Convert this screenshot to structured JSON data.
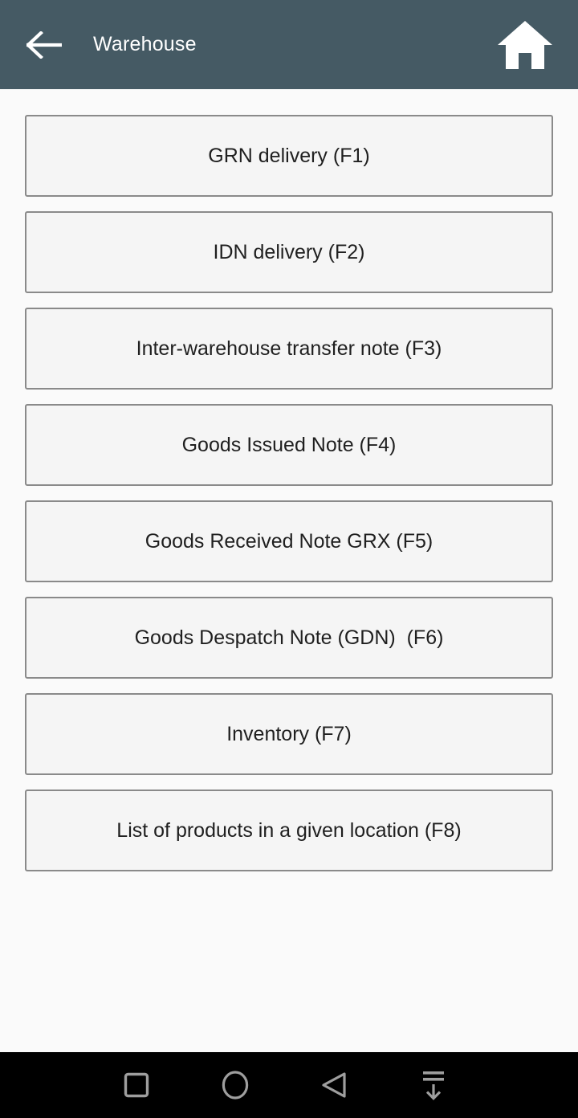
{
  "appbar": {
    "title": "Warehouse",
    "back_icon": "arrow-left-icon",
    "home_icon": "home-icon",
    "background_color": "#455a64",
    "text_color": "#ffffff"
  },
  "menu": {
    "buttons": [
      {
        "label": "GRN delivery (F1)",
        "shortcut": "F1"
      },
      {
        "label": "IDN delivery (F2)",
        "shortcut": "F2"
      },
      {
        "label": "Inter-warehouse transfer note (F3)",
        "shortcut": "F3"
      },
      {
        "label": "Goods Issued Note (F4)",
        "shortcut": "F4"
      },
      {
        "label": "Goods Received Note GRX (F5)",
        "shortcut": "F5"
      },
      {
        "label": "Goods Despatch Note (GDN)  (F6)",
        "shortcut": "F6"
      },
      {
        "label": "Inventory (F7)",
        "shortcut": "F7"
      },
      {
        "label": "List of products in a given location (F8)",
        "shortcut": "F8"
      }
    ],
    "button_background": "#f5f5f5",
    "button_border_color": "#8a8a8a",
    "button_text_color": "#1f1f1f",
    "page_background": "#fafafa"
  },
  "navbar": {
    "background_color": "#000000",
    "icon_color": "#9e9e9e",
    "items": [
      {
        "icon": "square-recents-icon",
        "label": "Recents"
      },
      {
        "icon": "circle-home-icon",
        "label": "Home"
      },
      {
        "icon": "triangle-back-icon",
        "label": "Back"
      },
      {
        "icon": "hide-keyboard-icon",
        "label": "Hide keyboard"
      }
    ]
  }
}
